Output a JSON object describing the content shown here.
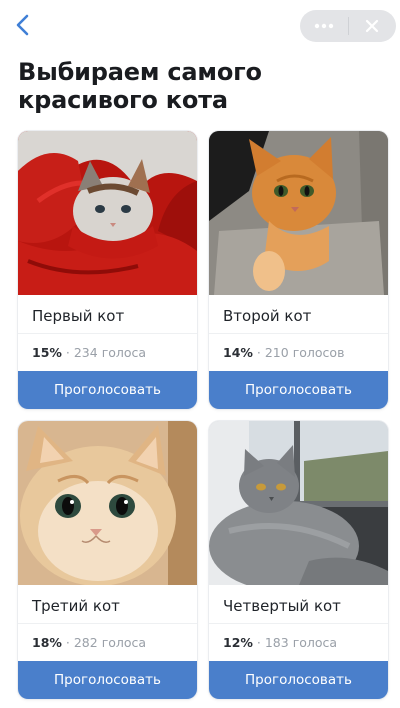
{
  "header": {
    "back_icon": "chevron-left-icon",
    "more_icon": "more-horizontal-icon",
    "close_icon": "close-icon",
    "title": "Выбираем самого красивого кота"
  },
  "cards": [
    {
      "name": "Первый кот",
      "percent": "15%",
      "votes": "234 голоса",
      "vote_label": "Проголосовать"
    },
    {
      "name": "Второй кот",
      "percent": "14%",
      "votes": "210 голосов",
      "vote_label": "Проголосовать"
    },
    {
      "name": "Третий кот",
      "percent": "18%",
      "votes": "282 голоса",
      "vote_label": "Проголосовать"
    },
    {
      "name": "Четвертый кот",
      "percent": "12%",
      "votes": "183 голоса",
      "vote_label": "Проголосовать"
    }
  ],
  "colors": {
    "accent": "#4a7fcb",
    "back_icon": "#3f7fd6"
  }
}
